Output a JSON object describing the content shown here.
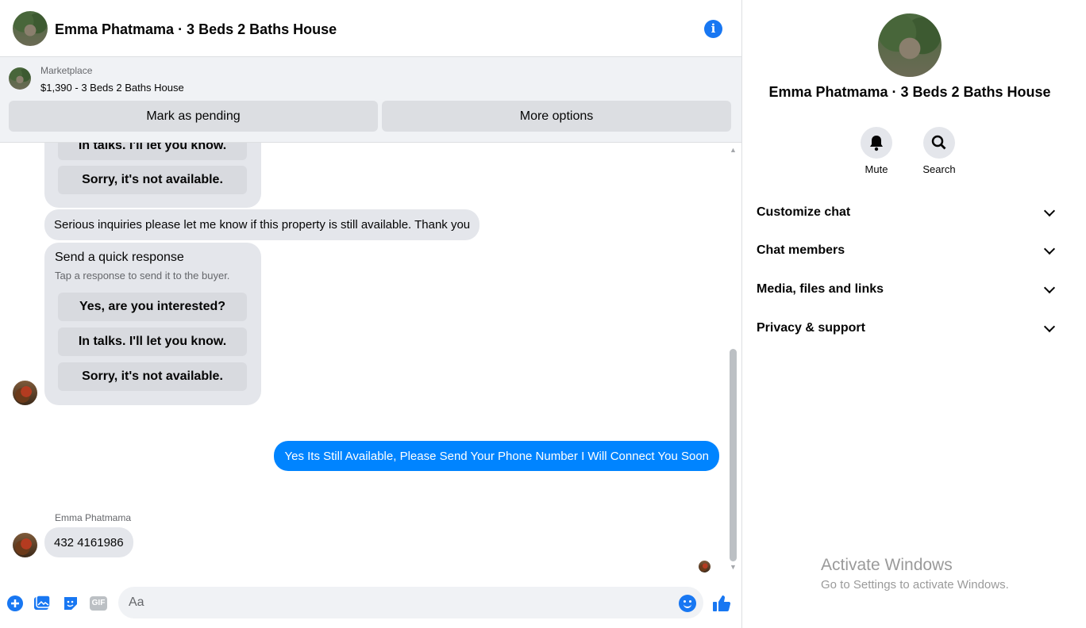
{
  "header": {
    "title": "Emma Phatmama · 3 Beds 2 Baths House"
  },
  "marketplace": {
    "label": "Marketplace",
    "listing": "$1,390 - 3 Beds 2 Baths House",
    "mark_pending": "Mark as pending",
    "more_options": "More options"
  },
  "thread": {
    "card1": {
      "btn_talks": "In talks. I'll let you know.",
      "btn_sorry": "Sorry, it's not available."
    },
    "inquiry": "Serious inquiries please let me know if this property is still available. Thank you",
    "card2": {
      "title": "Send a quick response",
      "subtitle": "Tap a response to send it to the buyer.",
      "btn_yes": "Yes, are you interested?",
      "btn_talks": "In talks. I'll let you know.",
      "btn_sorry": "Sorry, it's not available."
    },
    "outgoing": "Yes Its Still Available, Please Send Your Phone Number I Will Connect You Soon",
    "sender": "Emma Phatmama",
    "reply": "432 4161986"
  },
  "composer": {
    "placeholder": "Aa",
    "gif_label": "GIF"
  },
  "info": {
    "name": "Emma Phatmama · 3 Beds 2 Baths House",
    "mute": "Mute",
    "search": "Search",
    "sections": [
      "Customize chat",
      "Chat members",
      "Media, files and links",
      "Privacy & support"
    ]
  },
  "watermark": {
    "line1": "Activate Windows",
    "line2": "Go to Settings to activate Windows."
  },
  "colors": {
    "accent": "#1877f2",
    "outgoing_bubble": "#0084ff",
    "incoming_bubble": "#e4e6eb"
  }
}
